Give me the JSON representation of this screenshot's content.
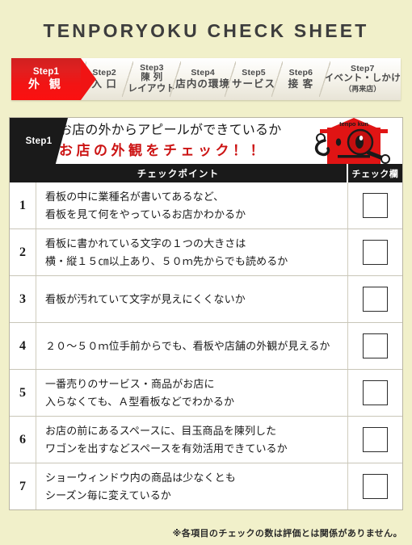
{
  "page": {
    "title": "TENPORYOKU CHECK SHEET",
    "footer_note": "※各項目のチェックの数は評価とは関係がありません。",
    "accent_red": "#cc1414",
    "background": "#f1f0ca",
    "header_black": "#1a1a1a"
  },
  "steps": [
    {
      "num": "Step1",
      "label": "外 観",
      "sub": "",
      "active": true
    },
    {
      "num": "Step2",
      "label": "入 口",
      "sub": "",
      "active": false
    },
    {
      "num": "Step3",
      "label": "陳 列",
      "sub": "レイアウト",
      "active": false
    },
    {
      "num": "Step4",
      "label": "店内の環境",
      "sub": "",
      "active": false
    },
    {
      "num": "Step5",
      "label": "サービス",
      "sub": "",
      "active": false
    },
    {
      "num": "Step6",
      "label": "接 客",
      "sub": "",
      "active": false
    },
    {
      "num": "Step7",
      "label": "イベント・しかけ",
      "sub": "（再来店）",
      "active": false
    }
  ],
  "banner": {
    "badge": "Step1",
    "line1": "お店の外からアピールができているか",
    "line2": "お店の外観をチェック！！",
    "mascot_label": "tenpo kun"
  },
  "table": {
    "header_checkpoint": "チェックポイント",
    "header_check_column": "チェック欄",
    "rows": [
      {
        "num": "1",
        "line1": "看板の中に業種名が書いてあるなど、",
        "line2": "看板を見て何をやっているお店かわかるか",
        "checked": false
      },
      {
        "num": "2",
        "line1": "看板に書かれている文字の１つの大きさは",
        "line2": "横・縦１５㎝以上あり、５０ｍ先からでも読めるか",
        "checked": false
      },
      {
        "num": "3",
        "line1": "看板が汚れていて文字が見えにくくないか",
        "line2": "",
        "checked": false
      },
      {
        "num": "4",
        "line1": "２０〜５０ｍ位手前からでも、看板や店舗の外観が見えるか",
        "line2": "",
        "checked": false
      },
      {
        "num": "5",
        "line1": "一番売りのサービス・商品がお店に",
        "line2": "入らなくても、Ａ型看板などでわかるか",
        "checked": false
      },
      {
        "num": "6",
        "line1": "お店の前にあるスペースに、目玉商品を陳列した",
        "line2": "ワゴンを出すなどスペースを有効活用できているか",
        "checked": false
      },
      {
        "num": "7",
        "line1": "ショーウィンドウ内の商品は少なくとも",
        "line2": "シーズン毎に変えているか",
        "checked": false
      }
    ]
  }
}
